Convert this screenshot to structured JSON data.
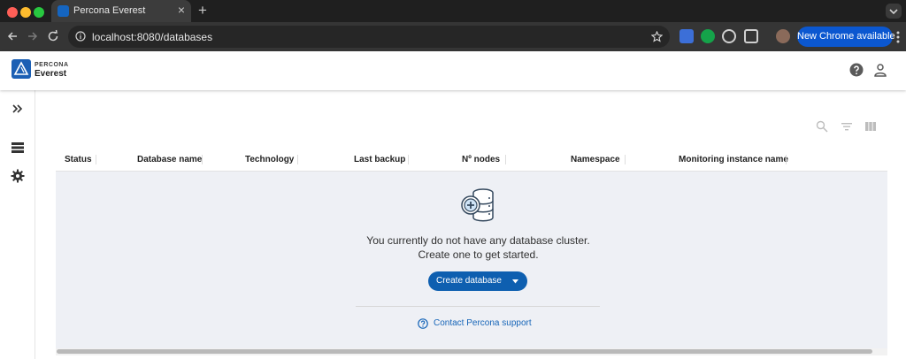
{
  "browser": {
    "tab_title": "Percona Everest",
    "tab_close": "×",
    "new_tab": "+",
    "url": "localhost:8080/databases",
    "new_chrome_label": "New Chrome available"
  },
  "app": {
    "logo_top": "PERCONA",
    "logo_bottom": "Everest"
  },
  "table": {
    "columns": [
      "Status",
      "Database name",
      "Technology",
      "Last backup",
      "Nº nodes",
      "Namespace",
      "Monitoring instance name"
    ]
  },
  "empty_state": {
    "line1": "You currently do not have any database cluster.",
    "line2": "Create one to get started.",
    "create_button": "Create database",
    "support_link": "Contact Percona support"
  },
  "colors": {
    "brand": "#1b5fb4",
    "primary_button": "#0e5fb0",
    "link": "#1665b8",
    "empty_background": "#eef0f5"
  },
  "icons": {
    "help": "help-circle-icon",
    "account": "account-icon",
    "expand": "chevrons-right-icon",
    "databases": "list-icon",
    "settings": "gear-icon",
    "search": "search-icon",
    "filter": "filter-icon",
    "columns": "columns-icon"
  }
}
